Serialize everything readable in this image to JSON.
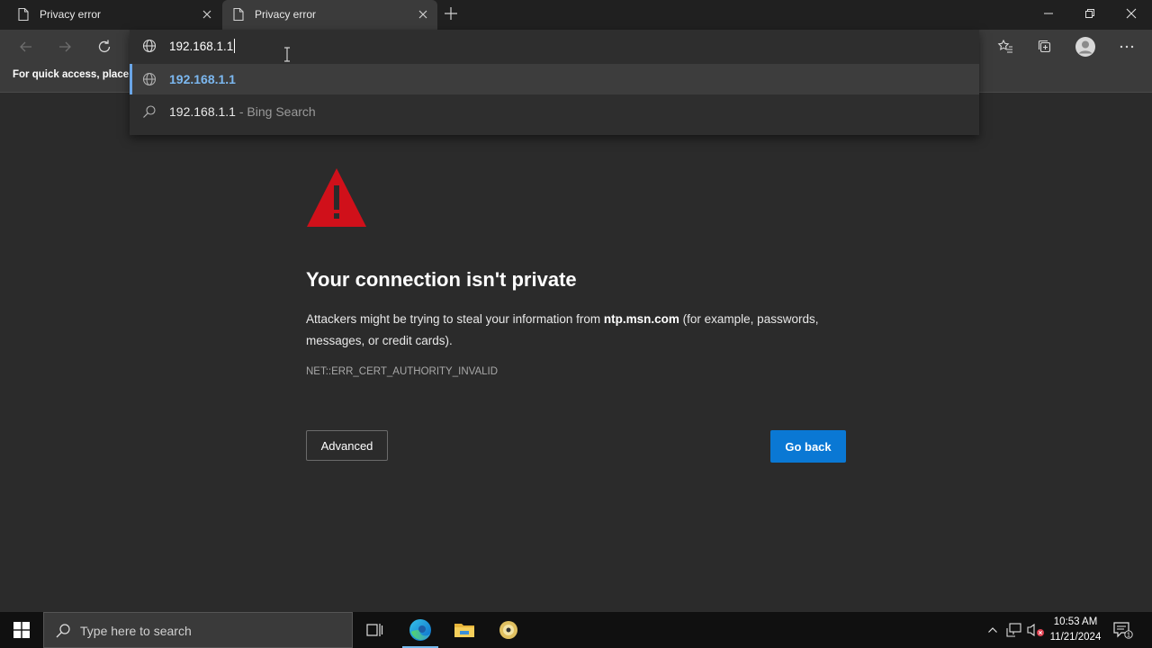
{
  "tabs": [
    {
      "title": "Privacy error",
      "active": false
    },
    {
      "title": "Privacy error",
      "active": true
    }
  ],
  "favorites_bar": {
    "text": "For quick access, place y"
  },
  "omnibox": {
    "value": "192.168.1.1",
    "suggestions": [
      {
        "text": "192.168.1.1",
        "icon": "globe-icon"
      },
      {
        "text": "192.168.1.1",
        "suffix": " - Bing Search",
        "icon": "search-icon"
      }
    ]
  },
  "page": {
    "heading": "Your connection isn't private",
    "body_prefix": "Attackers might be trying to steal your information from ",
    "host": "ntp.msn.com",
    "body_suffix": " (for example, passwords, messages, or credit cards).",
    "error_code": "NET::ERR_CERT_AUTHORITY_INVALID",
    "advanced_label": "Advanced",
    "go_back_label": "Go back"
  },
  "taskbar": {
    "search_placeholder": "Type here to search",
    "time": "10:53 AM",
    "date": "11/21/2024",
    "notification_count": "1"
  },
  "colors": {
    "accent": "#0a78d4",
    "warning": "#d0101a",
    "suggestion_text": "#7cb8f0"
  }
}
